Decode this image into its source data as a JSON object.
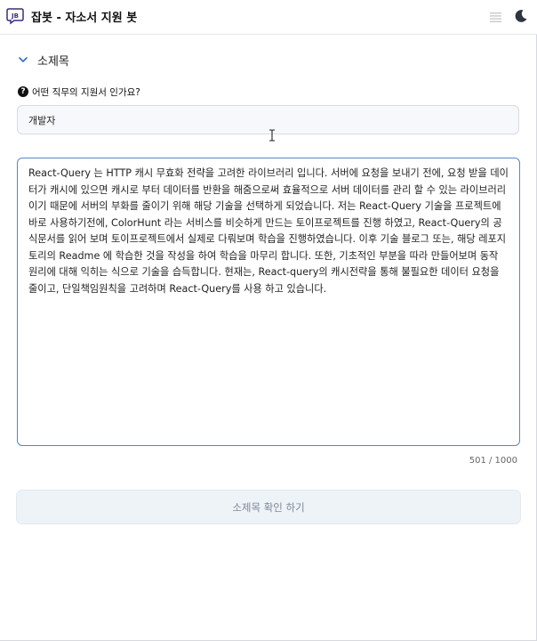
{
  "header": {
    "logo_icon": "chat-bubble-logo-icon",
    "title": "잡봇 - 자소서 지원 봇",
    "menu_icon": "hamburger-menu-icon",
    "theme_icon": "moon-icon"
  },
  "expander": {
    "label": "소제목",
    "icon": "chevron-down-icon"
  },
  "question": {
    "icon": "question-circle-icon",
    "label": "어떤 직무의 지원서 인가요?"
  },
  "job_input": {
    "value": "개발자",
    "placeholder": ""
  },
  "essay": {
    "text": "React-Query 는 HTTP 캐시 무효화 전략을 고려한 라이브러리 입니다. 서버에 요청을 보내기 전에, 요청 받을 데이터가 캐시에 있으면 캐시로 부터 데이터를 반환을 해줌으로써 효율적으로 서버 데이터를 관리 할 수 있는 라이브러리 이기 때문에 서버의 부화를 줄이기 위해 해당 기술을 선택하게 되었습니다. 저는 React-Query 기술을 프로젝트에 바로 사용하기전에, ColorHunt 라는 서비스를 비슷하게 만드는 토이프로젝트를 진행 하였고, React-Query의 공식문서를 읽어 보며 토이프로젝트에서 실제로 다뤄보며 학습을 진행하였습니다. 이후 기술 블로그 또는, 해당 레포지토리의 Readme 에 학습한 것을 작성을 하여 학습을 마무리 합니다. 또한, 기초적인 부분을 따라 만들어보며 동작 원리에 대해 익히는 식으로 기술을 습득합니다. 현재는, React-query의 캐시전략을 통해 불필요한 데이터 요청을 줄이고, 단일책임원칙을 고려하며 React-Query를 사용 하고 있습니다.",
    "counter": "501 / 1000"
  },
  "confirm_button": {
    "label": "소제목 확인 하기"
  },
  "colors": {
    "focus_border": "#5a86c4",
    "button_bg": "#eef3f8",
    "button_text": "#7d8896"
  }
}
